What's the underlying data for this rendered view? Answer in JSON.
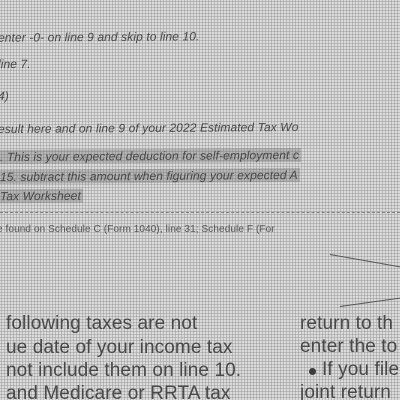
{
  "worksheet_lines": [
    "enter -0- on line 9 and skip to line 10.",
    "line 7.",
    "4)",
    "esult here and on line 9 of your 2022 Estimated Tax Wo",
    ". This is your expected deduction for self-employment c",
    "15. subtract this amount when figuring your expected A",
    "Tax Worksheet"
  ],
  "footnote": "e found on Schedule C (Form 1040), line 31; Schedule F (For",
  "left_column": [
    "following taxes are not",
    "ue date of your income tax",
    "not include them on line 10.",
    "and Medicare or RRTA tax"
  ],
  "right_column": [
    "return to th",
    "enter the to",
    "If you file",
    "joint return"
  ]
}
